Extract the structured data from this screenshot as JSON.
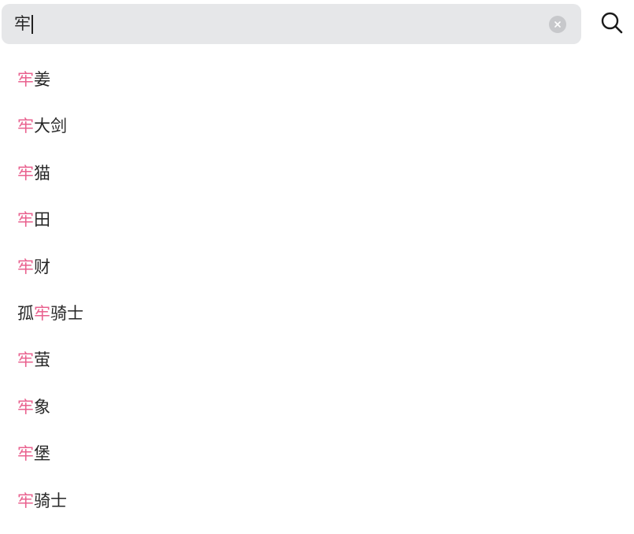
{
  "search": {
    "query": "牢"
  },
  "colors": {
    "highlight": "#e9628f",
    "search_bg": "#e6e7e9"
  },
  "icons": {
    "clear": "clear-circle-x-icon",
    "search": "magnifier-icon"
  },
  "results": [
    {
      "before": "",
      "match": "牢",
      "after": "姜"
    },
    {
      "before": "",
      "match": "牢",
      "after": "大剑"
    },
    {
      "before": "",
      "match": "牢",
      "after": "猫"
    },
    {
      "before": "",
      "match": "牢",
      "after": "田"
    },
    {
      "before": "",
      "match": "牢",
      "after": "财"
    },
    {
      "before": "孤",
      "match": "牢",
      "after": "骑士"
    },
    {
      "before": "",
      "match": "牢",
      "after": "萤"
    },
    {
      "before": "",
      "match": "牢",
      "after": "象"
    },
    {
      "before": "",
      "match": "牢",
      "after": "堡"
    },
    {
      "before": "",
      "match": "牢",
      "after": "骑士"
    }
  ]
}
